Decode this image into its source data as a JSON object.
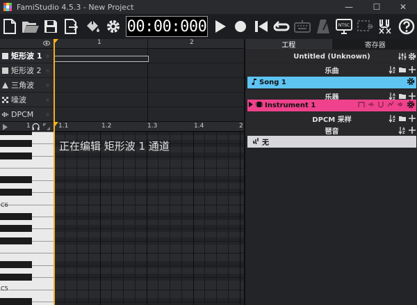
{
  "window": {
    "title": "FamiStudio 4.5.3 - New Project",
    "minimize": "—",
    "maximize": "☐",
    "close": "✕"
  },
  "toolbar": {
    "timer": "00:00:000",
    "tempo_badge": "NTSC"
  },
  "channels": [
    {
      "name": "矩形波 1",
      "icon": "square-wave-icon",
      "selected": true
    },
    {
      "name": "矩形波 2",
      "icon": "square-wave-icon",
      "selected": false
    },
    {
      "name": "三角波",
      "icon": "triangle-wave-icon",
      "selected": false
    },
    {
      "name": "噪波",
      "icon": "noise-icon",
      "selected": false
    },
    {
      "name": "DPCM",
      "icon": "dpcm-icon",
      "selected": false
    }
  ],
  "sequencer": {
    "bars": [
      "1",
      "2"
    ]
  },
  "piano_roll": {
    "zoom_label": "1",
    "beat_labels": [
      "1.1",
      "1.2",
      "1.3",
      "1.4",
      "2"
    ],
    "octave_labels": [
      "C6",
      "C5"
    ],
    "editing_message": "正在编辑 矩形波 1 通道"
  },
  "project_panel": {
    "tabs": [
      "工程",
      "寄存器"
    ],
    "project_title": "Untitled (Unknown)",
    "songs_header": "乐曲",
    "songs": [
      {
        "name": "Song 1",
        "color": "#5ec4f2"
      }
    ],
    "instruments_header": "乐器",
    "instruments": [
      {
        "name": "Instrument 1",
        "color": "#f0428c"
      }
    ],
    "dpcm_header": "DPCM 采样",
    "arpeggios_header": "琶音",
    "arpeggios": [
      {
        "name": "无",
        "color": "#d8d8dc"
      }
    ]
  },
  "colors": {
    "playhead": "#f2b01c",
    "selection_song": "#5ec4f2",
    "selection_instrument": "#f0428c"
  }
}
